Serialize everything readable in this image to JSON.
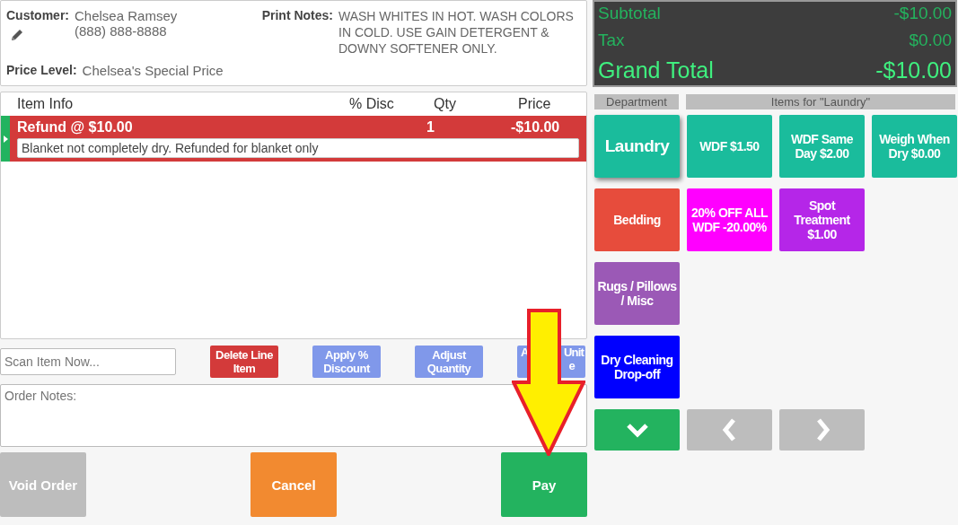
{
  "customer": {
    "label": "Customer:",
    "name": "Chelsea Ramsey",
    "phone": "(888) 888-8888"
  },
  "print_notes": {
    "label": "Print Notes:",
    "text": "WASH WHITES IN HOT. WASH COLORS IN COLD. USE GAIN DETERGENT & DOWNY SOFTENER ONLY."
  },
  "price_level": {
    "label": "Price Level:",
    "value": "Chelsea's Special Price"
  },
  "table": {
    "columns": [
      "Item Info",
      "% Disc",
      "Qty",
      "Price"
    ],
    "rows": [
      {
        "item": "Refund @ $10.00",
        "disc": "",
        "qty": "1",
        "price": "-$10.00",
        "note": "Blanket not completely dry. Refunded for blanket only",
        "selected": true
      }
    ]
  },
  "scan_field": {
    "placeholder": "Scan Item Now..."
  },
  "actions": [
    {
      "label": "Delete Line Item",
      "color": "#d33a3a"
    },
    {
      "label": "Apply % Discount",
      "color": "#8098ea"
    },
    {
      "label": "Adjust Quantity",
      "color": "#8098ea"
    },
    {
      "kind": "covered",
      "lines": [
        [
          "A",
          "Unit"
        ],
        [
          "e"
        ]
      ],
      "color": "#8098ea"
    }
  ],
  "order_notes": {
    "placeholder": "Order Notes:"
  },
  "bottom_buttons": [
    {
      "label": "Void Order",
      "color": "#bdbdbd"
    },
    {
      "label": "Cancel",
      "color": "#f28a30"
    },
    {
      "label": "Pay",
      "color": "#23b35f"
    }
  ],
  "totals": [
    {
      "label": "Subtotal",
      "value": "-$10.00",
      "kind": "normal"
    },
    {
      "label": "Tax",
      "value": "$0.00",
      "kind": "normal"
    },
    {
      "label": "Grand Total",
      "value": "-$10.00",
      "kind": "grand"
    }
  ],
  "department_header": "Department",
  "items_header": "Items for \"Laundry\"",
  "departments": [
    {
      "label": "Laundry",
      "color": "#1abc9c",
      "selected": true
    },
    {
      "label": "Bedding",
      "color": "#e74c3c",
      "selected": false
    },
    {
      "label": "Rugs / Pillows / Misc",
      "color": "#9b59b6",
      "selected": false
    },
    {
      "label": "Dry Cleaning Drop-off",
      "color": "#0000ff",
      "selected": false
    }
  ],
  "items": [
    {
      "label": "WDF $1.50",
      "color": "#1abc9c"
    },
    {
      "label": "WDF Same Day $2.00",
      "color": "#1abc9c"
    },
    {
      "label": "Weigh When Dry $0.00",
      "color": "#1abc9c"
    },
    {
      "label": "20% OFF ALL WDF -20.00%",
      "color": "#ff00ff"
    },
    {
      "label": "Spot Treatment $1.00",
      "color": "#b526e8"
    }
  ],
  "nav_buttons": [
    {
      "kind": "down"
    },
    {
      "kind": "prev"
    },
    {
      "kind": "next"
    }
  ]
}
